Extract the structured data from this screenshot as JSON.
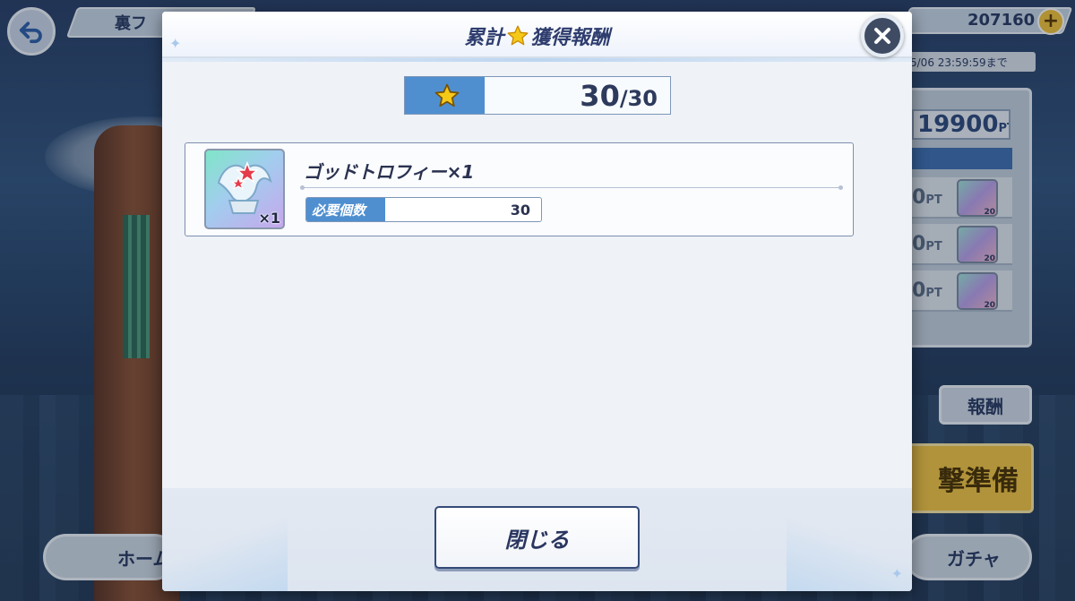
{
  "background": {
    "back_icon": "back-arrow-icon",
    "top_label": "裏フ",
    "currency_value": "207160",
    "plus_icon": "plus-icon",
    "deadline": "5/06 23:59:59まで",
    "points": "19900",
    "points_unit": "PT",
    "reward_rows": [
      {
        "pt": "0",
        "unit": "PT"
      },
      {
        "pt": "0",
        "unit": "PT"
      },
      {
        "pt": "0",
        "unit": "PT"
      }
    ],
    "rewards_button": "報酬",
    "ready_button": "撃準備",
    "home_button": "ホーム",
    "gacha_button": "ガチャ"
  },
  "modal": {
    "title_prefix": "累計",
    "title_suffix": "獲得報酬",
    "title_icon": "star-icon",
    "progress": {
      "current": "30",
      "max": "/30",
      "fraction": 0.3
    },
    "reward": {
      "name": "ゴッドトロフィー×1",
      "quantity": "×1",
      "icon": "trophy-icon",
      "required_label": "必要個数",
      "required_value": "30"
    },
    "close_button": "閉じる"
  },
  "colors": {
    "accent_blue": "#4f8fd0",
    "title_navy": "#2e3d6e",
    "star_yellow": "#f5c918"
  }
}
